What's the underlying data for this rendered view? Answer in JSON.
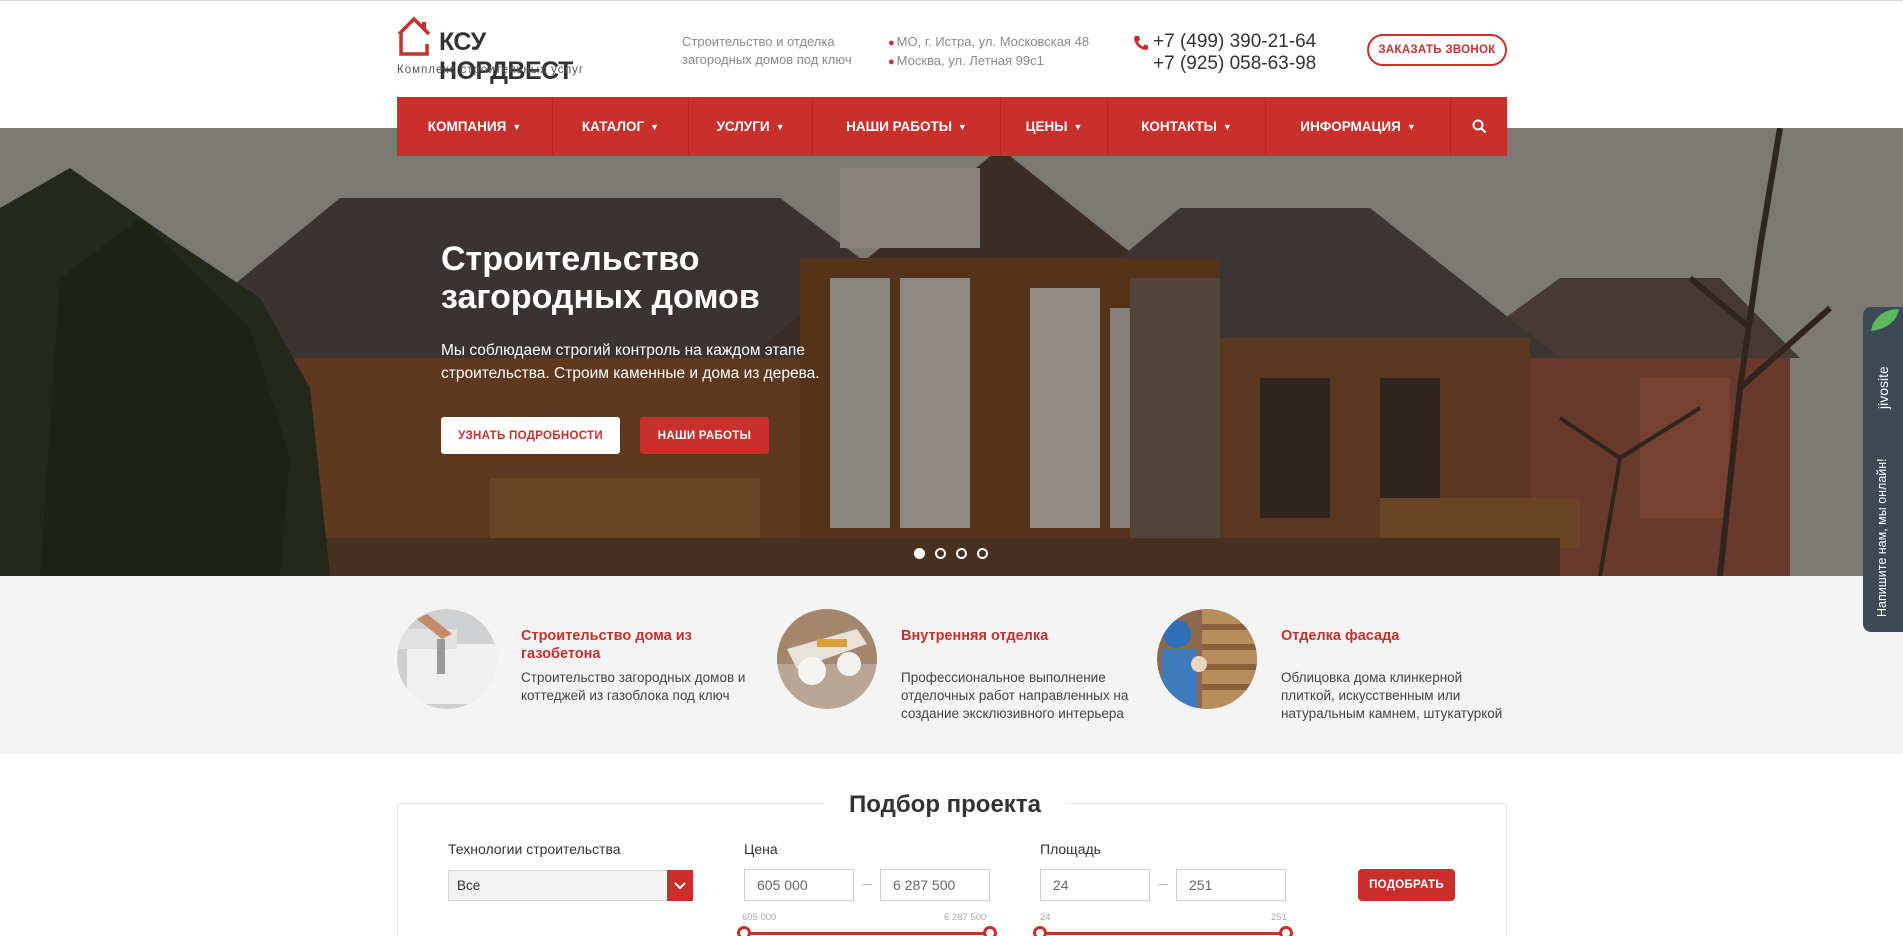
{
  "header": {
    "logo_name": "КСУ НОРДВЕСТ",
    "logo_sub": "Комплекс строительных услуг",
    "tagline_1": "Строительство и отделка",
    "tagline_2": "загородных домов под ключ",
    "address_1": "МО, г. Истра, ул. Московская 48",
    "address_2": "Москва, ул. Летная 99с1",
    "phone_1": "+7 (499) 390-21-64",
    "phone_2": "+7 (925) 058-63-98",
    "callback_label": "ЗАКАЗАТЬ ЗВОНОК"
  },
  "nav": {
    "items": [
      {
        "label": "КОМПАНИЯ"
      },
      {
        "label": "КАТАЛОГ"
      },
      {
        "label": "УСЛУГИ"
      },
      {
        "label": "НАШИ РАБОТЫ"
      },
      {
        "label": "ЦЕНЫ"
      },
      {
        "label": "КОНТАКТЫ"
      },
      {
        "label": "ИНФОРМАЦИЯ"
      }
    ],
    "search_icon": "search-icon"
  },
  "hero": {
    "title_1": "Строительство",
    "title_2": "загородных домов",
    "text_1": "Мы соблюдаем строгий контроль на каждом этапе",
    "text_2": "строительства. Строим каменные и дома из дерева.",
    "btn_details": "УЗНАТЬ ПОДРОБНОСТИ",
    "btn_works": "НАШИ РАБОТЫ",
    "slides_count": 4,
    "active_slide": 1
  },
  "chat": {
    "brand": "jivosite",
    "label": "Напишите нам, мы онлайн!"
  },
  "features": [
    {
      "title": "Строительство дома из газобетона",
      "desc": "Строительство загородных домов и коттеджей из газоблока под ключ"
    },
    {
      "title": "Внутренняя отделка",
      "desc": "Профессиональное выполнение отделочных работ направленных на создание эксклюзивного интерьера"
    },
    {
      "title": "Отделка фасада",
      "desc": "Облицовка дома клинкерной плиткой, искусственным или натуральным камнем, штукатуркой"
    }
  ],
  "selector": {
    "title": "Подбор проекта",
    "tech_label": "Технологии строительства",
    "tech_value": "Все",
    "price_label": "Цена",
    "price_from": "605 000",
    "price_to": "6 287 500",
    "price_min": "605 000",
    "price_max": "6 287 500",
    "area_label": "Площадь",
    "area_from": "24",
    "area_to": "251",
    "area_min": "24",
    "area_max": "251",
    "pick_label": "ПОДОБРАТЬ"
  },
  "colors": {
    "accent": "#c9302c",
    "chat_bg": "#3b4a55",
    "features_bg": "#f4f4f4"
  }
}
